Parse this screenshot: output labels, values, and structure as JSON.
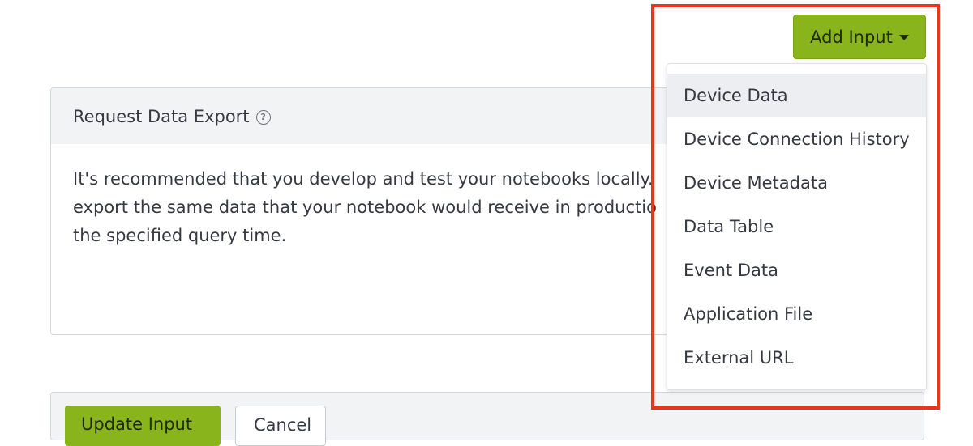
{
  "toolbar": {
    "add_input_label": "Add Input"
  },
  "panel": {
    "title": "Request Data Export",
    "body_lines": [
      "It's recommended that you develop and test your notebooks locally.",
      "export the same data that your notebook would receive in productio",
      "the specified query time."
    ]
  },
  "footer": {
    "update_label": "Update Input",
    "cancel_label": "Cancel"
  },
  "dropdown": {
    "items": [
      {
        "label": "Device Data"
      },
      {
        "label": "Device Connection History"
      },
      {
        "label": "Device Metadata"
      },
      {
        "label": "Data Table"
      },
      {
        "label": "Event Data"
      },
      {
        "label": "Application File"
      },
      {
        "label": "External URL"
      }
    ]
  },
  "colors": {
    "accent": "#89b41b",
    "highlight": "#e8361c"
  }
}
